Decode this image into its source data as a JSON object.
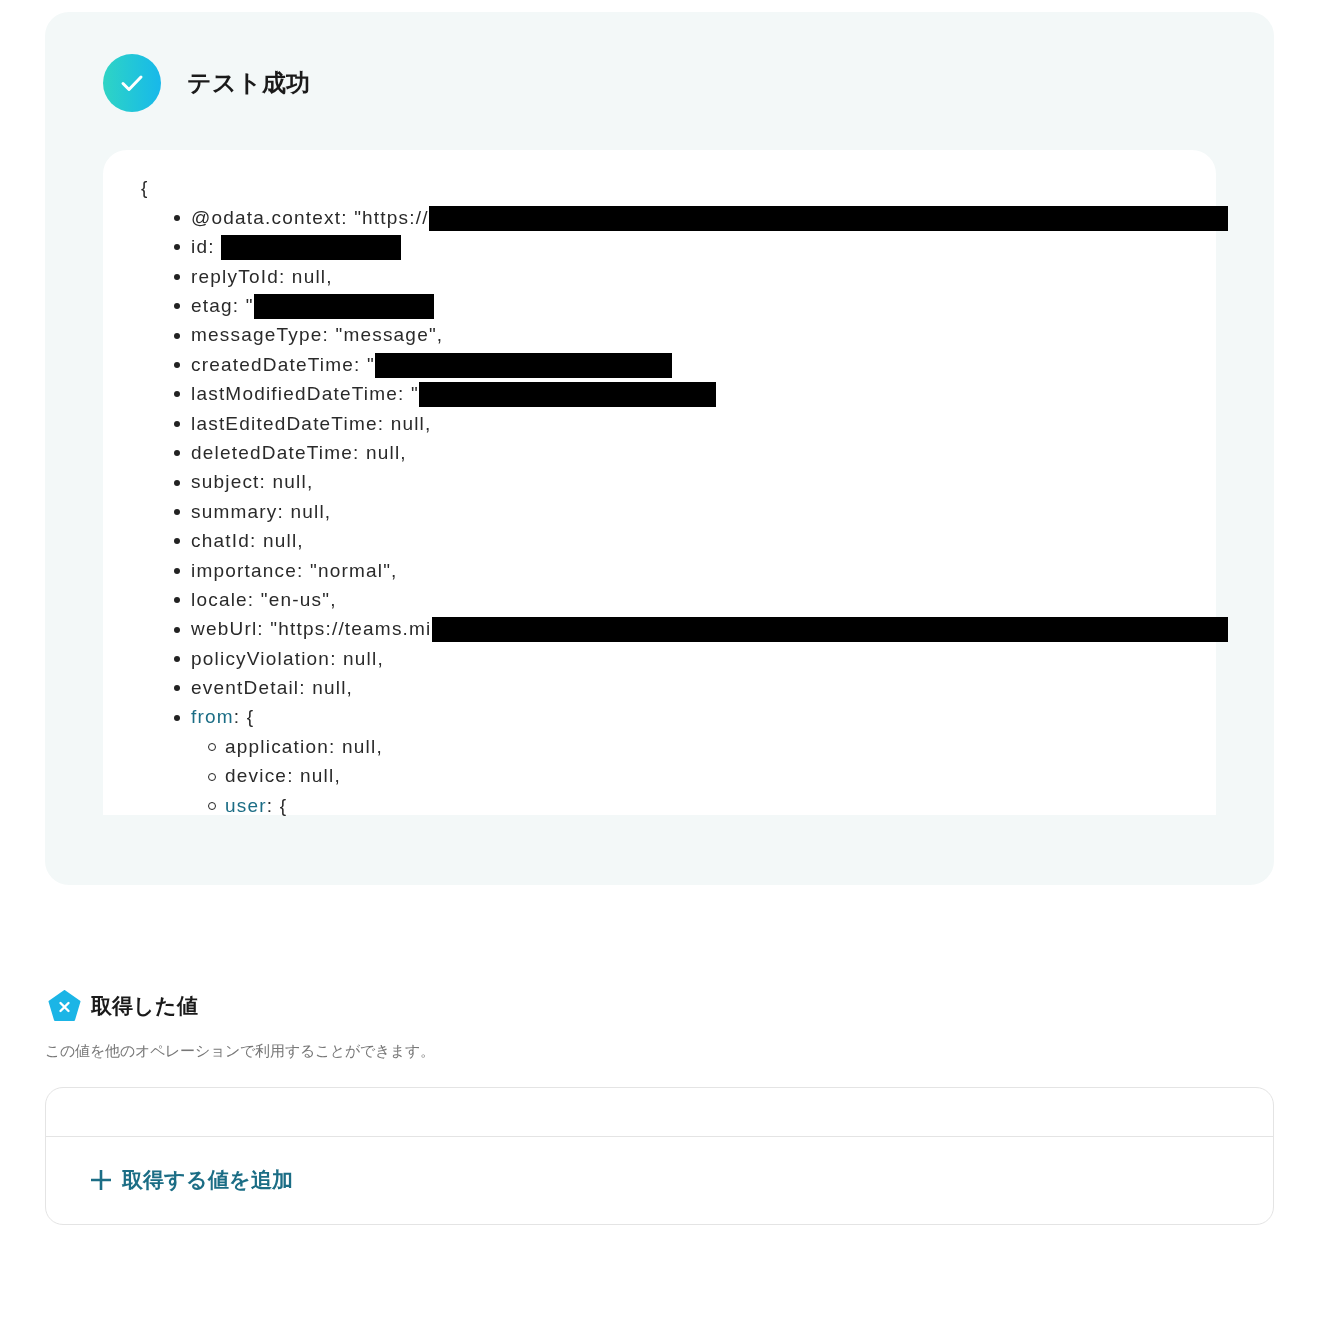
{
  "result": {
    "title": "テスト成功",
    "open_brace": "{",
    "items": [
      {
        "key": "@odata.context",
        "value": ": \"https://",
        "kind": "redacted_long"
      },
      {
        "key": "id",
        "value": ": ",
        "kind": "redacted_short"
      },
      {
        "key": "replyToId",
        "value": ": null,",
        "kind": "plain"
      },
      {
        "key": "etag",
        "value": ": \"",
        "kind": "redacted_short"
      },
      {
        "key": "messageType",
        "value": ": \"message\",",
        "kind": "plain"
      },
      {
        "key": "createdDateTime",
        "value": ": \"",
        "kind": "redacted_medium"
      },
      {
        "key": "lastModifiedDateTime",
        "value": ": \"",
        "kind": "redacted_medium"
      },
      {
        "key": "lastEditedDateTime",
        "value": ": null,",
        "kind": "plain"
      },
      {
        "key": "deletedDateTime",
        "value": ": null,",
        "kind": "plain"
      },
      {
        "key": "subject",
        "value": ": null,",
        "kind": "plain"
      },
      {
        "key": "summary",
        "value": ": null,",
        "kind": "plain"
      },
      {
        "key": "chatId",
        "value": ": null,",
        "kind": "plain"
      },
      {
        "key": "importance",
        "value": ": \"normal\",",
        "kind": "plain"
      },
      {
        "key": "locale",
        "value": ": \"en-us\",",
        "kind": "plain"
      },
      {
        "key": "webUrl",
        "value": ": \"https://teams.mi",
        "kind": "redacted_long"
      },
      {
        "key": "policyViolation",
        "value": ": null,",
        "kind": "plain"
      },
      {
        "key": "eventDetail",
        "value": ": null,",
        "kind": "plain"
      },
      {
        "key": "from",
        "value": ": {",
        "kind": "object",
        "children": [
          {
            "key": "application",
            "value": ": null,",
            "kind": "plain"
          },
          {
            "key": "device",
            "value": ": null,",
            "kind": "plain"
          },
          {
            "key": "user",
            "value": ": {",
            "kind": "object"
          }
        ]
      }
    ]
  },
  "values_section": {
    "title": "取得した値",
    "description": "この値を他のオペレーションで利用することができます。",
    "add_button": "取得する値を追加"
  }
}
